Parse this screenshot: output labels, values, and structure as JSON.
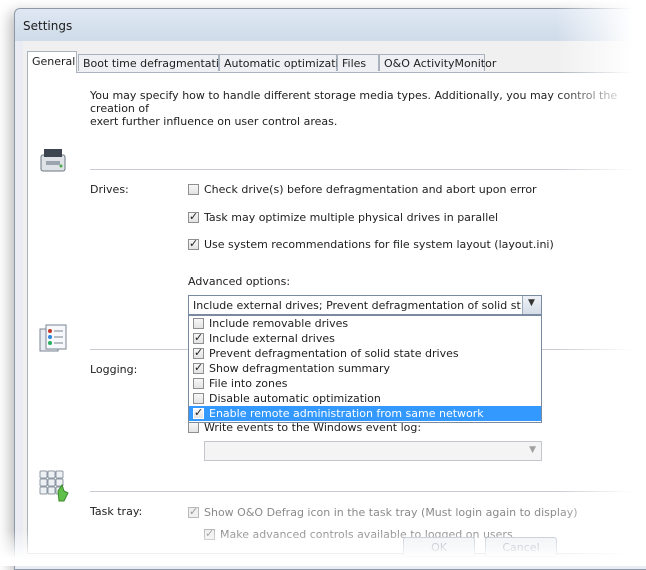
{
  "window": {
    "title": "Settings"
  },
  "tabs": [
    {
      "label": "General",
      "active": true
    },
    {
      "label": "Boot time defragmentation"
    },
    {
      "label": "Automatic optimization"
    },
    {
      "label": "Files"
    },
    {
      "label": "O&O ActivityMonitor"
    }
  ],
  "intro": {
    "line1": "You may specify how to handle different storage media types. Additionally, you may control the creation of",
    "line2": "exert further influence on user control areas."
  },
  "drives": {
    "label": "Drives:",
    "options": [
      {
        "label": "Check drive(s) before defragmentation and abort upon error",
        "checked": false
      },
      {
        "label": "Task may optimize multiple physical drives in parallel",
        "checked": true
      },
      {
        "label": "Use system recommendations for file system layout (layout.ini)",
        "checked": true
      }
    ],
    "advanced_label": "Advanced options:",
    "advanced_value": "Include external drives; Prevent defragmentation of solid state dr...",
    "advanced_items": [
      {
        "label": "Include removable drives",
        "checked": false
      },
      {
        "label": "Include external drives",
        "checked": true
      },
      {
        "label": "Prevent defragmentation of solid state drives",
        "checked": true
      },
      {
        "label": "Show defragmentation summary",
        "checked": true
      },
      {
        "label": "File into zones",
        "checked": false
      },
      {
        "label": "Disable automatic optimization",
        "checked": false
      },
      {
        "label": "Enable remote administration from same network",
        "checked": true,
        "highlighted": true
      }
    ]
  },
  "logging": {
    "label": "Logging:",
    "write_events_label": "Write events to the Windows event log:",
    "write_events_checked": false
  },
  "task_tray": {
    "label": "Task tray:",
    "show_icon_label": "Show O&O Defrag icon in the task tray (Must login again to display)",
    "show_icon_checked": true,
    "advanced_controls_label": "Make advanced controls available to logged on users",
    "advanced_controls_checked": true
  },
  "buttons": {
    "ok": "OK",
    "cancel": "Cancel"
  },
  "icons": [
    "drive-icon",
    "log-icon",
    "keypad-icon",
    "dropdown-arrow-icon",
    "checkmark-icon"
  ],
  "colors": {
    "selection": "#3399ff",
    "titlebar": "#d6e1ee"
  }
}
